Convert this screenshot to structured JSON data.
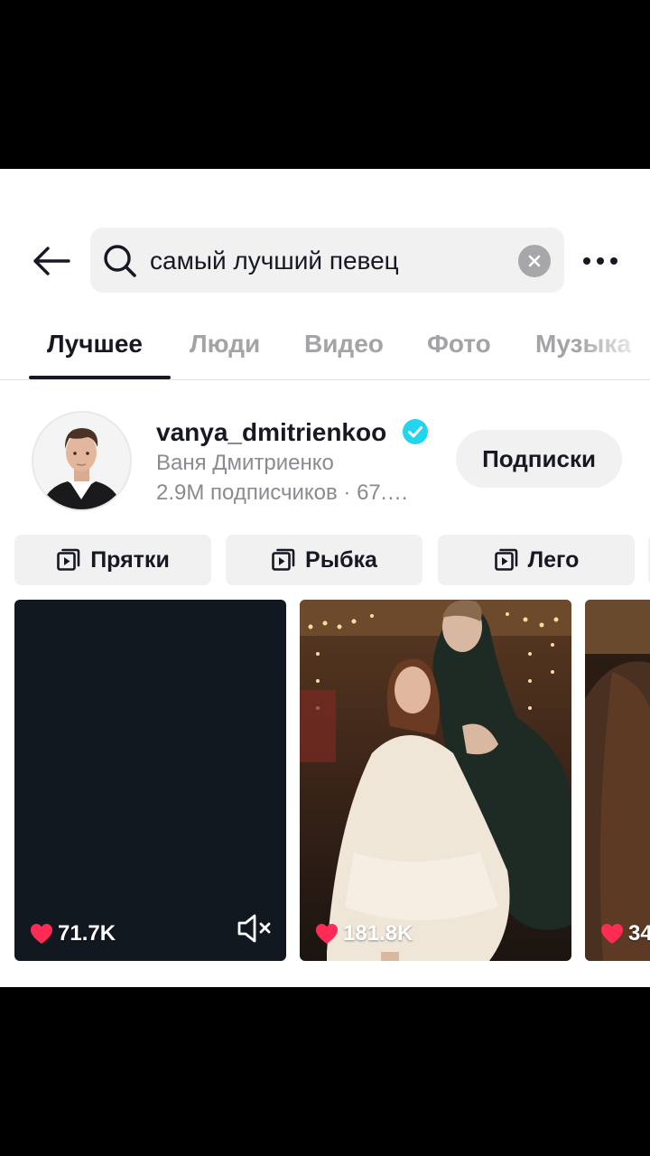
{
  "search": {
    "query": "самый лучший певец"
  },
  "tabs": [
    {
      "label": "Лучшее",
      "active": true
    },
    {
      "label": "Люди",
      "active": false
    },
    {
      "label": "Видео",
      "active": false
    },
    {
      "label": "Фото",
      "active": false
    },
    {
      "label": "Музыка",
      "active": false
    }
  ],
  "profile": {
    "username": "vanya_dmitrienkoo",
    "display_name": "Ваня Дмитриенко",
    "stats": "2.9M подписчиков · 67.…",
    "follow_label": "Подписки",
    "verified": true
  },
  "chips": [
    {
      "label": "Прятки",
      "icon": "video-playlist-icon"
    },
    {
      "label": "Рыбка",
      "icon": "video-playlist-icon"
    },
    {
      "label": "Лего",
      "icon": "video-playlist-icon"
    }
  ],
  "videos": [
    {
      "likes": "71.7K",
      "muted": true
    },
    {
      "likes": "181.8K",
      "muted": false
    },
    {
      "likes": "34",
      "muted": false
    }
  ],
  "colors": {
    "like_heart": "#fe2c55",
    "verified_badge": "#20d5ec",
    "text_primary": "#161823",
    "text_secondary": "#8a8b91"
  }
}
